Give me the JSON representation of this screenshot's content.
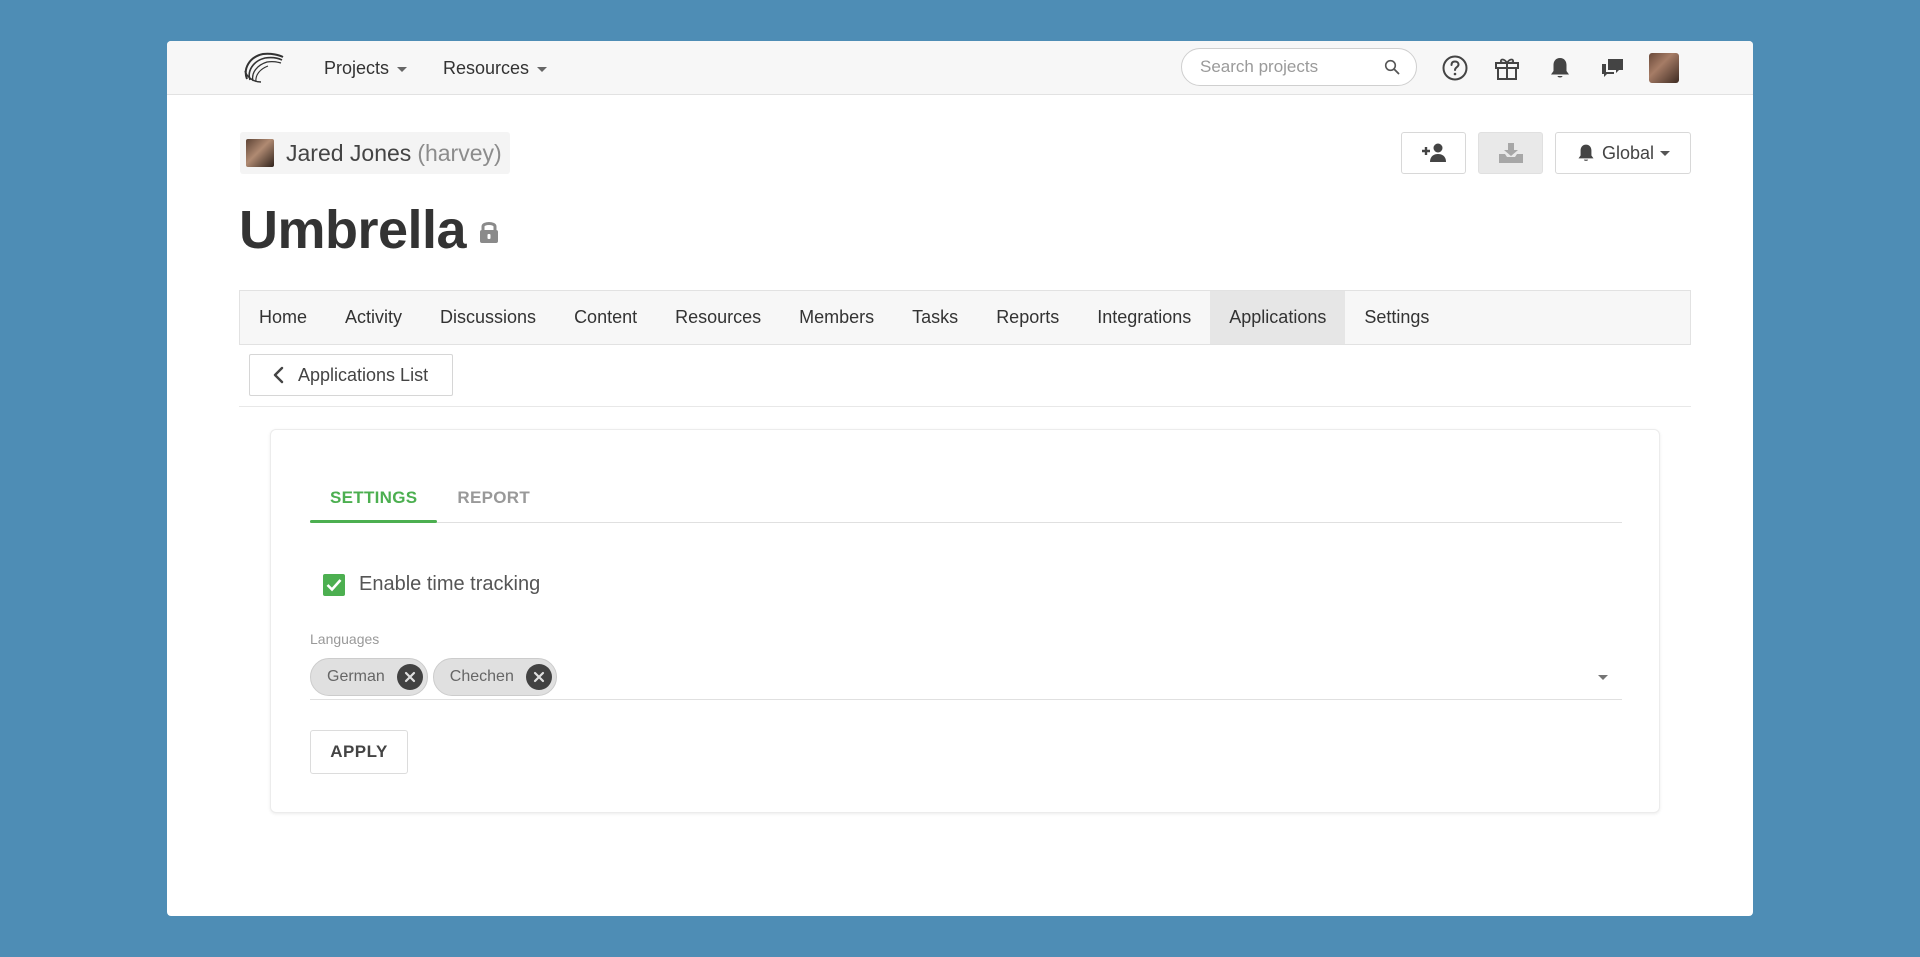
{
  "topnav": {
    "menus": [
      {
        "label": "Projects"
      },
      {
        "label": "Resources"
      }
    ],
    "search": {
      "placeholder": "Search projects"
    }
  },
  "header": {
    "user_name": "Jared Jones",
    "user_handle": "(harvey)",
    "notification_label": "Global",
    "project_title": "Umbrella"
  },
  "tabs": [
    {
      "label": "Home"
    },
    {
      "label": "Activity"
    },
    {
      "label": "Discussions"
    },
    {
      "label": "Content"
    },
    {
      "label": "Resources"
    },
    {
      "label": "Members"
    },
    {
      "label": "Tasks"
    },
    {
      "label": "Reports"
    },
    {
      "label": "Integrations"
    },
    {
      "label": "Applications",
      "active": true
    },
    {
      "label": "Settings"
    }
  ],
  "back_button": {
    "label": "Applications List"
  },
  "app": {
    "tabs": [
      {
        "label": "SETTINGS",
        "active": true
      },
      {
        "label": "REPORT"
      }
    ],
    "enable_time_tracking": {
      "label": "Enable time tracking",
      "checked": true
    },
    "languages": {
      "label": "Languages",
      "selected": [
        "German",
        "Chechen"
      ]
    },
    "apply_label": "APPLY"
  },
  "colors": {
    "background": "#4e8db5",
    "accent_green": "#4caf50"
  }
}
